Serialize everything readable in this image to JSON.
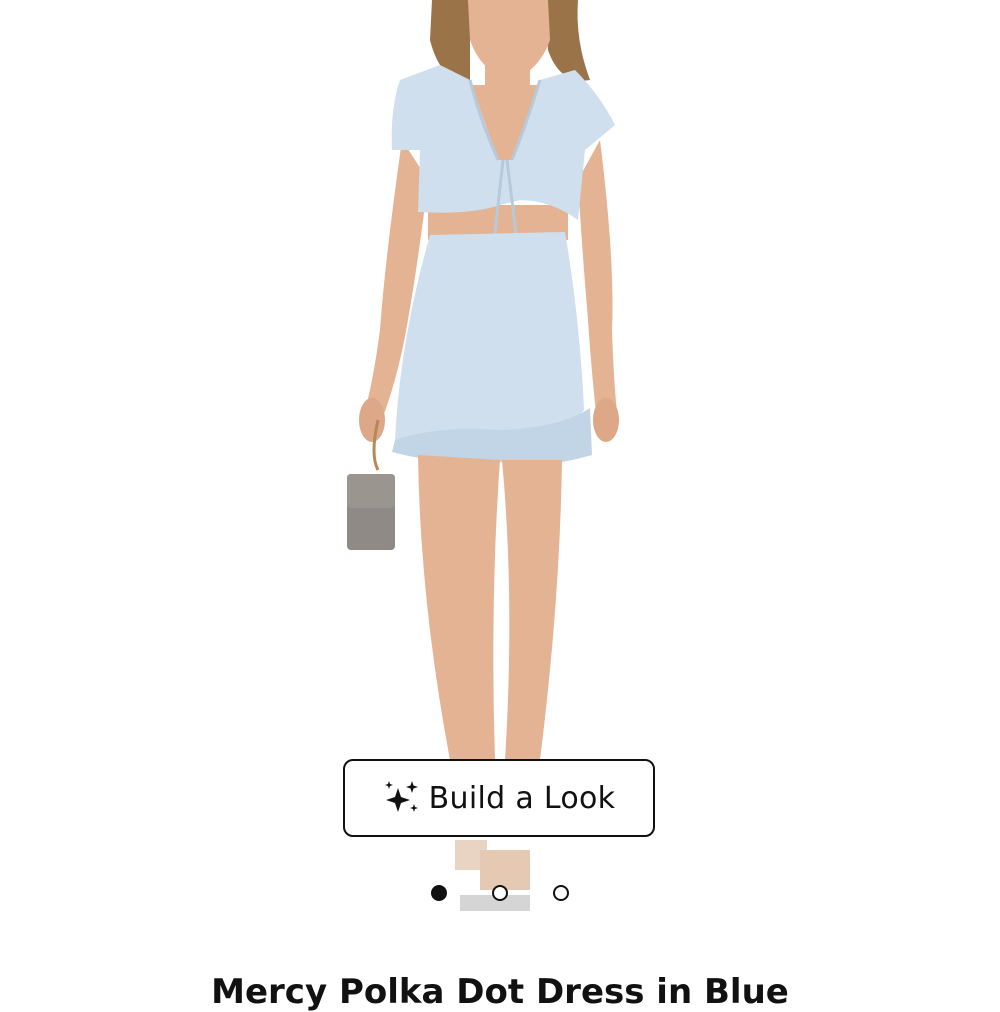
{
  "product": {
    "title": "Mercy Polka Dot Dress in Blue",
    "dress_color": "#cfdfee",
    "skin_color": "#e4b394"
  },
  "actions": {
    "build_look_label": "Build a Look",
    "build_look_icon": "sparkles-icon"
  },
  "carousel": {
    "total": 3,
    "active_index": 0
  }
}
